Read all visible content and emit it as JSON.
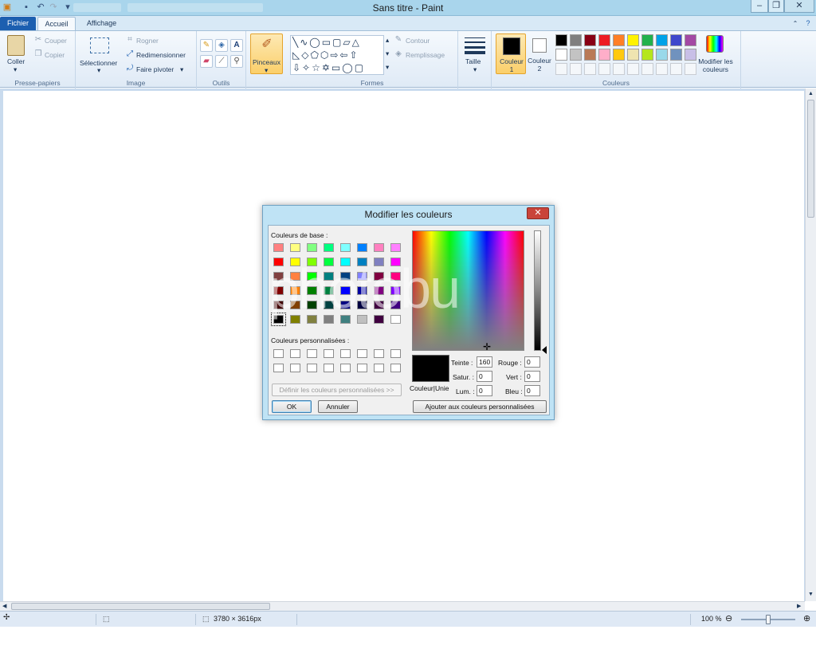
{
  "window": {
    "title": "Sans titre - Paint",
    "minimize": "‒",
    "restore": "❐",
    "close": "✕"
  },
  "tabs": {
    "file": "Fichier",
    "home": "Accueil",
    "view": "Affichage"
  },
  "ribbon": {
    "clipboard": {
      "paste": "Coller",
      "cut": "Couper",
      "copy": "Copier",
      "label": "Presse-papiers"
    },
    "image": {
      "select": "Sélectionner",
      "crop": "Rogner",
      "resize": "Redimensionner",
      "rotate": "Faire pivoter",
      "label": "Image"
    },
    "tools": {
      "label": "Outils"
    },
    "brushes": {
      "label": "Pinceaux"
    },
    "shapes": {
      "outline": "Contour",
      "fill": "Remplissage",
      "label": "Formes"
    },
    "size": {
      "label": "Taille"
    },
    "colors": {
      "color1": "Couleur 1",
      "color2": "Couleur 2",
      "edit": "Modifier les couleurs",
      "label": "Couleurs",
      "palette_row1": [
        "#000000",
        "#7f7f7f",
        "#880015",
        "#ed1c24",
        "#ff7f27",
        "#fff200",
        "#22b14c",
        "#00a2e8",
        "#3f48cc",
        "#a349a4"
      ],
      "palette_row2": [
        "#ffffff",
        "#c3c3c3",
        "#b97a57",
        "#ffaec9",
        "#ffc90e",
        "#efe4b0",
        "#b5e61d",
        "#99d9ea",
        "#7092be",
        "#c8bfe7"
      ]
    }
  },
  "dialog": {
    "title": "Modifier les couleurs",
    "basic_label": "Couleurs de base :",
    "custom_label": "Couleurs personnalisées :",
    "define_custom": "Définir les couleurs personnalisées >>",
    "ok": "OK",
    "cancel": "Annuler",
    "add_custom": "Ajouter aux couleurs personnalisées",
    "preview_label": "Couleur|Unie",
    "fields": {
      "hue_label": "Teinte :",
      "hue": "160",
      "sat_label": "Satur. :",
      "sat": "0",
      "lum_label": "Lum. :",
      "lum": "0",
      "red_label": "Rouge :",
      "red": "0",
      "green_label": "Vert :",
      "green": "0",
      "blue_label": "Bleu :",
      "blue": "0"
    },
    "basic_colors": [
      "#ff8080",
      "#ffff80",
      "#80ff80",
      "#00ff80",
      "#80ffff",
      "#0080ff",
      "#ff80c0",
      "#ff80ff",
      "#ff0000",
      "#ffff00",
      "#80ff00",
      "#00ff40",
      "#00ffff",
      "#0080c0",
      "#8080c0",
      "#ff00ff",
      "#804040",
      "#ff8040",
      "#00ff00",
      "#008080",
      "#004080",
      "#8080ff",
      "#800040",
      "#ff0080",
      "#800000",
      "#ff8000",
      "#008000",
      "#008040",
      "#0000ff",
      "#0000a0",
      "#800080",
      "#8000ff",
      "#400000",
      "#804000",
      "#004000",
      "#004040",
      "#000080",
      "#000040",
      "#400040",
      "#400080",
      "#000000",
      "#808000",
      "#808040",
      "#808080",
      "#408080",
      "#c0c0c0",
      "#400040",
      "#ffffff"
    ]
  },
  "watermark": "photobu",
  "status": {
    "dimensions": "3780 × 3616px",
    "zoom": "100 %"
  }
}
